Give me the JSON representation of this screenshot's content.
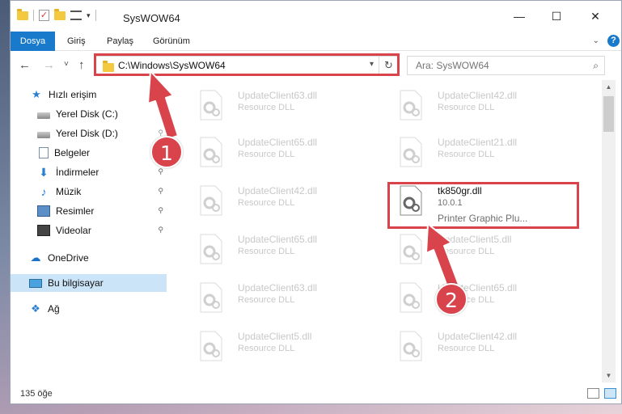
{
  "window": {
    "title": "SysWOW64",
    "minimize_glyph": "—",
    "maximize_glyph": "☐",
    "close_glyph": "✕"
  },
  "ribbon": {
    "tabs": [
      "Dosya",
      "Giriş",
      "Paylaş",
      "Görünüm"
    ],
    "help_glyph": "?"
  },
  "nav": {
    "back_glyph": "←",
    "forward_glyph": "→",
    "recent_glyph": "˅",
    "up_glyph": "↑",
    "address": "C:\\Windows\\SysWOW64",
    "search_placeholder": "Ara: SysWOW64"
  },
  "sidebar": {
    "items": [
      {
        "label": "Hızlı erişim",
        "icon": "star-icon",
        "glyph": "★",
        "pinned": false
      },
      {
        "label": "Yerel Disk (C:)",
        "icon": "disk-icon",
        "glyph": "",
        "pinned": true
      },
      {
        "label": "Yerel Disk (D:)",
        "icon": "disk-icon",
        "glyph": "",
        "pinned": true
      },
      {
        "label": "Belgeler",
        "icon": "document-icon",
        "glyph": "",
        "pinned": true
      },
      {
        "label": "İndirmeler",
        "icon": "download-icon",
        "glyph": "⬇",
        "pinned": true
      },
      {
        "label": "Müzik",
        "icon": "music-icon",
        "glyph": "♪",
        "pinned": true
      },
      {
        "label": "Resimler",
        "icon": "pictures-icon",
        "glyph": "",
        "pinned": true
      },
      {
        "label": "Videolar",
        "icon": "videos-icon",
        "glyph": "",
        "pinned": true
      },
      {
        "label": "OneDrive",
        "icon": "cloud-icon",
        "glyph": "☁",
        "pinned": false
      },
      {
        "label": "Bu bilgisayar",
        "icon": "computer-icon",
        "glyph": "",
        "pinned": false,
        "selected": true
      },
      {
        "label": "Ağ",
        "icon": "network-icon",
        "glyph": "❖",
        "pinned": false
      }
    ],
    "pin_glyph": "📌"
  },
  "files": [
    {
      "name": "UpdateClient63.dll",
      "type": "Resource DLL"
    },
    {
      "name": "UpdateClient42.dll",
      "type": "Resource DLL"
    },
    {
      "name": "UpdateClient65.dll",
      "type": "Resource DLL"
    },
    {
      "name": "UpdateClient21.dll",
      "type": "Resource DLL"
    },
    {
      "name": "UpdateClient42.dll",
      "type": "Resource DLL"
    },
    {
      "name": "tk850gr.dll",
      "version": "10.0.1",
      "type": "Printer Graphic Plu...",
      "highlighted": true
    },
    {
      "name": "UpdateClient65.dll",
      "type": "Resource DLL"
    },
    {
      "name": "UpdateClient5.dll",
      "type": "Resource DLL"
    },
    {
      "name": "UpdateClient63.dll",
      "type": "Resource DLL"
    },
    {
      "name": "UpdateClient65.dll",
      "type": "Resource DLL"
    },
    {
      "name": "UpdateClient5.dll",
      "type": "Resource DLL"
    },
    {
      "name": "UpdateClient42.dll",
      "type": "Resource DLL"
    }
  ],
  "status": {
    "item_count": "135 öğe"
  },
  "annotations": {
    "marker1": "1",
    "marker2": "2",
    "color": "#d9444c"
  },
  "colors": {
    "accent": "#1979ca",
    "selected_bg": "#cce4f7"
  }
}
